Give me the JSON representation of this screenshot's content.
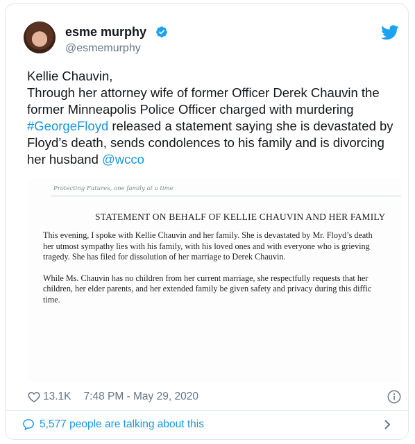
{
  "author": {
    "display_name": "esme murphy",
    "handle": "@esmemurphy"
  },
  "tweet": {
    "line1": "Kellie Chauvin,",
    "part1": "Through her attorney wife of former Officer Derek Chauvin the former Minneapolis Police Officer charged with murdering ",
    "hashtag": "#GeorgeFloyd",
    "part2": " released a statement saying she is devastated by Floyd’s death, sends condolences to his family and is divorcing her husband ",
    "mention": "@wcco"
  },
  "media": {
    "letterhead": "Protecting Futures, one family at a time",
    "title": "STATEMENT ON BEHALF OF KELLIE CHAUVIN AND HER FAMILY",
    "p1_l1": "This evening, I spoke with Kellie Chauvin and her family. She is devastated by Mr. Floyd’s death",
    "p1_l2": "her utmost sympathy lies with his family, with his loved ones and with everyone who is grieving",
    "p1_l3": "tragedy. She has filed for dissolution of her marriage to Derek Chauvin.",
    "p2_l1": "While Ms. Chauvin has no children from her current marriage, she respectfully requests that her",
    "p2_l2": "children, her elder parents, and her extended family be given safety and privacy during this diffic",
    "p2_l3": "time."
  },
  "meta": {
    "likes": "13.1K",
    "timestamp": "7:48 PM - May 29, 2020"
  },
  "conversation": {
    "label": "5,577 people are talking about this"
  },
  "colors": {
    "link": "#1b95e0",
    "muted": "#657786",
    "border": "#e1e8ed"
  },
  "icons": [
    "verified-icon",
    "twitter-bird-icon",
    "heart-icon",
    "info-icon",
    "speech-bubble-icon",
    "chevron-right-icon"
  ]
}
